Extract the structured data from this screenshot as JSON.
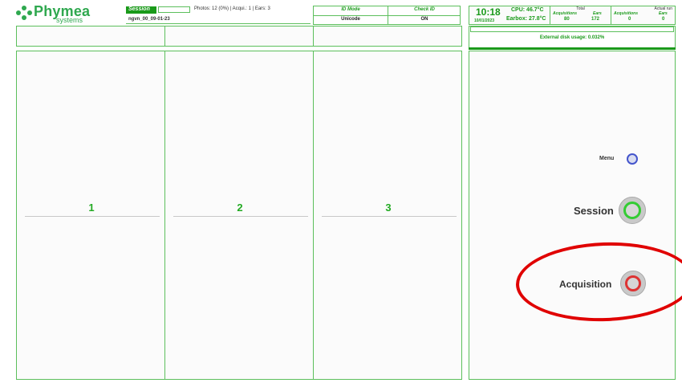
{
  "logo": {
    "name": "Phymea",
    "tagline": "systems"
  },
  "session": {
    "tab_label": "Session",
    "stats": "Photos: 12 (0%) | Acqui.: 1 | Ears: 3",
    "name": "ngvn_00_09-01-23"
  },
  "id_mode": {
    "label": "ID Mode",
    "value": "Unicode"
  },
  "check_id": {
    "label": "Check ID",
    "value": "ON"
  },
  "status": {
    "time": "10:18",
    "date": "10/01/2023",
    "cpu": "CPU: 46.7°C",
    "earbox": "Earbox: 27.8°C",
    "total_label": "Total",
    "actual_label": "Actual run",
    "acquisitions_label": "Acquisitions",
    "ears_label": "Ears",
    "total_acquisitions": "80",
    "total_ears": "172",
    "actual_acquisitions": "0",
    "actual_ears": "0"
  },
  "disk": {
    "text": "External disk usage: 0.032%"
  },
  "columns": [
    {
      "label": "1"
    },
    {
      "label": "2"
    },
    {
      "label": "3"
    }
  ],
  "menu": {
    "label": "Menu"
  },
  "session_button": {
    "label": "Session"
  },
  "acquisition_button": {
    "label": "Acquisition"
  },
  "colors": {
    "accent": "#1a9a1a",
    "session_ring": "#33cc33",
    "acquisition_ring": "#dd3333",
    "menu_ring": "#4455cc",
    "annotation": "#e00000"
  }
}
